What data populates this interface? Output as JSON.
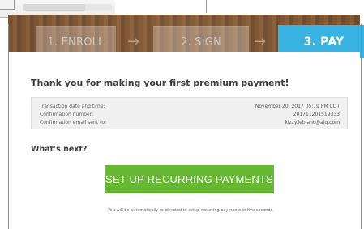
{
  "steps": {
    "enroll": "1. ENROLL",
    "sign": "2. SIGN",
    "pay": "3. PAY",
    "arrow": "→"
  },
  "confirmation": {
    "title": "Thank you for making your first premium payment!",
    "rows": [
      {
        "label": "Transaction date and time:",
        "value": "November 20, 2017 05:19 PM CDT"
      },
      {
        "label": "Confirmation number:",
        "value": "201711201519333"
      },
      {
        "label": "Confirmation email sent to:",
        "value": "kizzy.leblanc@aig.com"
      }
    ]
  },
  "next": {
    "heading": "What's next?",
    "button_label": "SET UP RECURRING PAYMENTS",
    "note": "You will be automatically re-directed to setup recurring payments in five seconds."
  },
  "colors": {
    "active_step": "#39b3e2",
    "button": "#67b934",
    "text_dark": "#3e3e3e"
  }
}
